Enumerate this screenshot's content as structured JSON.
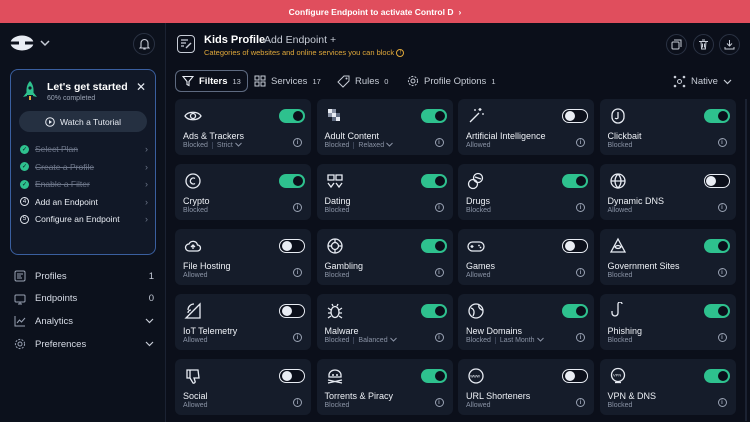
{
  "banner": {
    "text": "Configure Endpoint to activate Control D",
    "chevron": "›"
  },
  "sidebar": {
    "getting_started": {
      "title": "Let's get started",
      "progress_text": "60% completed",
      "progress": 0.6,
      "tutorial_label": "Watch a Tutorial",
      "steps": [
        {
          "label": "Select Plan",
          "done": true
        },
        {
          "label": "Create a Profile",
          "done": true
        },
        {
          "label": "Enable a Filter",
          "done": true
        },
        {
          "label": "Add an Endpoint",
          "done": false,
          "number": "4"
        },
        {
          "label": "Configure an Endpoint",
          "done": false,
          "number": "5"
        }
      ]
    },
    "nav": [
      {
        "label": "Profiles",
        "count": "1",
        "icon": "profiles-icon"
      },
      {
        "label": "Endpoints",
        "count": "0",
        "icon": "endpoints-icon"
      },
      {
        "label": "Analytics",
        "count": "",
        "icon": "analytics-icon"
      },
      {
        "label": "Preferences",
        "count": "",
        "icon": "gear-icon"
      }
    ]
  },
  "header": {
    "title": "Kids Profile",
    "add_endpoint": "Add Endpoint +",
    "subtitle": "Categories of websites and online services you can block"
  },
  "tabs": [
    {
      "label": "Filters",
      "count": "13",
      "active": true
    },
    {
      "label": "Services",
      "count": "17",
      "active": false
    },
    {
      "label": "Rules",
      "count": "0",
      "active": false
    },
    {
      "label": "Profile Options",
      "count": "1",
      "active": false
    }
  ],
  "resolver": {
    "label": "Native"
  },
  "colors": {
    "accent": "#2ec18e",
    "banner": "#e04e5d",
    "warning": "#e0a83a"
  },
  "filters": [
    {
      "name": "Ads & Trackers",
      "status": "Blocked",
      "mode": "Strict",
      "enabled": true,
      "icon": "eye-icon"
    },
    {
      "name": "Adult Content",
      "status": "Blocked",
      "mode": "Relaxed",
      "enabled": true,
      "icon": "pixelated-icon"
    },
    {
      "name": "Artificial Intelligence",
      "status": "Allowed",
      "mode": "",
      "enabled": false,
      "icon": "magic-wand-icon"
    },
    {
      "name": "Clickbait",
      "status": "Blocked",
      "mode": "",
      "enabled": true,
      "icon": "fishhook-icon"
    },
    {
      "name": "Crypto",
      "status": "Blocked",
      "mode": "",
      "enabled": true,
      "icon": "coin-icon"
    },
    {
      "name": "Dating",
      "status": "Blocked",
      "mode": "",
      "enabled": true,
      "icon": "hearts-icon"
    },
    {
      "name": "Drugs",
      "status": "Blocked",
      "mode": "",
      "enabled": true,
      "icon": "pills-icon"
    },
    {
      "name": "Dynamic DNS",
      "status": "Allowed",
      "mode": "",
      "enabled": false,
      "icon": "globe-icon"
    },
    {
      "name": "File Hosting",
      "status": "Allowed",
      "mode": "",
      "enabled": false,
      "icon": "cloud-upload-icon"
    },
    {
      "name": "Gambling",
      "status": "Blocked",
      "mode": "",
      "enabled": true,
      "icon": "chip-icon"
    },
    {
      "name": "Games",
      "status": "Allowed",
      "mode": "",
      "enabled": false,
      "icon": "gamepad-icon"
    },
    {
      "name": "Government Sites",
      "status": "Blocked",
      "mode": "",
      "enabled": true,
      "icon": "pyramid-eye-icon"
    },
    {
      "name": "IoT Telemetry",
      "status": "Allowed",
      "mode": "",
      "enabled": false,
      "icon": "signal-icon"
    },
    {
      "name": "Malware",
      "status": "Blocked",
      "mode": "Balanced",
      "enabled": true,
      "icon": "bug-icon"
    },
    {
      "name": "New Domains",
      "status": "Blocked",
      "mode": "Last Month",
      "enabled": true,
      "icon": "new-globe-icon"
    },
    {
      "name": "Phishing",
      "status": "Blocked",
      "mode": "",
      "enabled": true,
      "icon": "hook-icon"
    },
    {
      "name": "Social",
      "status": "Allowed",
      "mode": "",
      "enabled": false,
      "icon": "thumbs-down-icon"
    },
    {
      "name": "Torrents & Piracy",
      "status": "Blocked",
      "mode": "",
      "enabled": true,
      "icon": "pirate-icon"
    },
    {
      "name": "URL Shorteners",
      "status": "Allowed",
      "mode": "",
      "enabled": false,
      "icon": "www-icon"
    },
    {
      "name": "VPN & DNS",
      "status": "Blocked",
      "mode": "",
      "enabled": true,
      "icon": "vpn-icon"
    }
  ]
}
